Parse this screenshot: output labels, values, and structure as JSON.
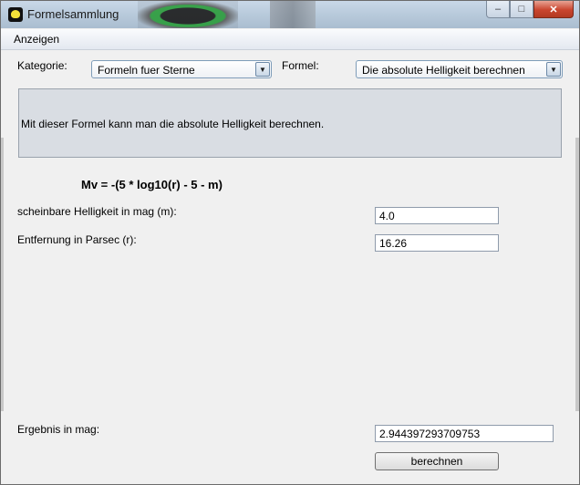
{
  "window": {
    "title": "Formelsammlung",
    "controls": {
      "minimize": "–",
      "maximize": "□",
      "close": "✕"
    }
  },
  "menubar": {
    "items": [
      {
        "label": "Anzeigen"
      }
    ]
  },
  "selection": {
    "category_label": "Kategorie:",
    "category_value": "Formeln fuer Sterne",
    "formula_label": "Formel:",
    "formula_value": "Die absolute Helligkeit berechnen",
    "dropdown_glyph": "▼"
  },
  "description": "Mit dieser Formel kann man die absolute Helligkeit berechnen.",
  "formula": "Mv = -(5 * log10(r) - 5 - m)",
  "inputs": [
    {
      "label": "scheinbare Helligkeit in mag (m):",
      "value": "4.0"
    },
    {
      "label": "Entfernung in Parsec (r):",
      "value": "16.26"
    }
  ],
  "result": {
    "label": "Ergebnis in mag:",
    "value": "2.944397293709753"
  },
  "actions": {
    "compute_label": "berechnen"
  },
  "icons": {
    "app": "app-icon-yellow-speech"
  }
}
